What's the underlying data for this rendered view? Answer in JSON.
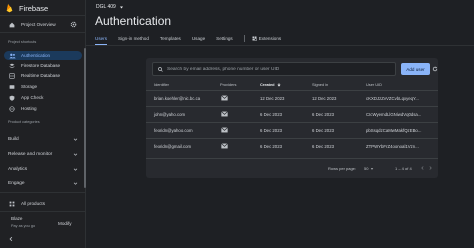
{
  "app": {
    "name": "Firebase"
  },
  "sidebar": {
    "project_overview": "Project Overview",
    "shortcuts_label": "Project shortcuts",
    "shortcuts": [
      {
        "label": "Authentication",
        "icon": "people-icon",
        "active": true
      },
      {
        "label": "Firestore Database",
        "icon": "firestore-icon"
      },
      {
        "label": "Realtime Database",
        "icon": "database-icon"
      },
      {
        "label": "Storage",
        "icon": "storage-icon"
      },
      {
        "label": "App Check",
        "icon": "shield-icon"
      },
      {
        "label": "Hosting",
        "icon": "hosting-icon"
      }
    ],
    "categories_label": "Product categories",
    "categories": [
      "Build",
      "Release and monitor",
      "Analytics",
      "Engage"
    ],
    "all_products": "All products",
    "plan_name": "Blaze",
    "plan_desc": "Pay as you go",
    "modify_label": "Modify"
  },
  "header": {
    "project_name": "DGL 409",
    "title": "Authentication",
    "tabs": [
      "Users",
      "Sign-in method",
      "Templates",
      "Usage",
      "Settings"
    ],
    "extensions_tab": "Extensions"
  },
  "users_table": {
    "search_placeholder": "Search by email address, phone number or user UID",
    "add_user_label": "Add user",
    "columns": [
      "Identifier",
      "Providers",
      "Created",
      "Signed in",
      "User UID"
    ],
    "sorted_column": "Created",
    "rows": [
      {
        "identifier": "brian.koehler@nic.bc.ca",
        "created": "12 Dec 2023",
        "signed_in": "12 Dec 2023",
        "uid": "cKXDJzZvVZCvbLqxyeqY..."
      },
      {
        "identifier": "john@yaho.com",
        "created": "6 Dec 2023",
        "signed_in": "6 Dec 2023",
        "uid": "CIcWyemdLlGNiwdVq0dsa..."
      },
      {
        "identifier": "feoridn@yahoo.com",
        "created": "6 Dec 2023",
        "signed_in": "6 Dec 2023",
        "uid": "pbSsqdzCaMwMakfQzEBo..."
      },
      {
        "identifier": "feoridn@gmail.com",
        "created": "6 Dec 2023",
        "signed_in": "6 Dec 2023",
        "uid": "ZTPWYbFrZ4oonoal1Vzn..."
      }
    ],
    "rows_per_page_label": "Rows per page:",
    "rows_per_page_value": "50",
    "range_label": "1 – 4 of 4"
  },
  "colors": {
    "accent": "#8ab4f8",
    "background": "#1e2024",
    "card": "#282a2f",
    "active_nav": "#1b3a5c"
  }
}
